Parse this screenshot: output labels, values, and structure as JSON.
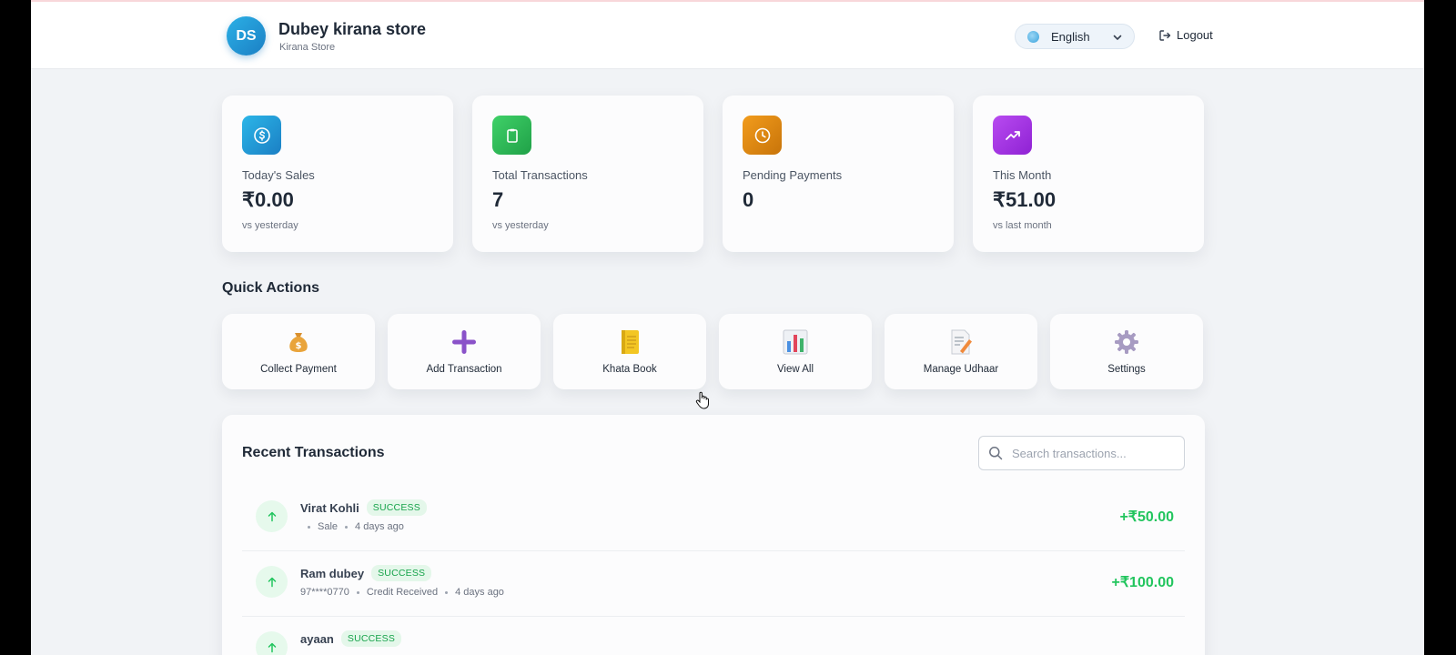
{
  "header": {
    "avatar_initials": "DS",
    "store_name": "Dubey kirana store",
    "store_type": "Kirana Store",
    "language": "English",
    "logout_label": "Logout"
  },
  "stats": [
    {
      "label": "Today's Sales",
      "value": "₹0.00",
      "sub": "vs yesterday",
      "icon": "dollar-icon",
      "color": "#2396d1"
    },
    {
      "label": "Total Transactions",
      "value": "7",
      "sub": "vs yesterday",
      "icon": "clipboard-icon",
      "color": "#2fb757"
    },
    {
      "label": "Pending Payments",
      "value": "0",
      "sub": "",
      "icon": "clock-icon",
      "color": "#e08a12"
    },
    {
      "label": "This Month",
      "value": "₹51.00",
      "sub": "vs last month",
      "icon": "trending-up-icon",
      "color": "#a436e6"
    }
  ],
  "quick_actions": {
    "title": "Quick Actions",
    "items": [
      {
        "label": "Collect Payment",
        "icon": "money-bag-icon"
      },
      {
        "label": "Add Transaction",
        "icon": "plus-icon"
      },
      {
        "label": "Khata Book",
        "icon": "notebook-icon"
      },
      {
        "label": "View All",
        "icon": "bar-chart-icon"
      },
      {
        "label": "Manage Udhaar",
        "icon": "memo-icon"
      },
      {
        "label": "Settings",
        "icon": "gear-icon"
      }
    ]
  },
  "recent": {
    "title": "Recent Transactions",
    "search_placeholder": "Search transactions...",
    "transactions": [
      {
        "name": "Virat Kohli",
        "status": "SUCCESS",
        "phone": "",
        "type": "Sale",
        "time": "4 days ago",
        "amount": "+₹50.00"
      },
      {
        "name": "Ram dubey",
        "status": "SUCCESS",
        "phone": "97****0770",
        "type": "Credit Received",
        "time": "4 days ago",
        "amount": "+₹100.00"
      },
      {
        "name": "ayaan",
        "status": "SUCCESS",
        "phone": "",
        "type": "",
        "time": "",
        "amount": ""
      }
    ]
  },
  "colors": {
    "success_green": "#22c55e",
    "background": "#f1f3f6"
  }
}
